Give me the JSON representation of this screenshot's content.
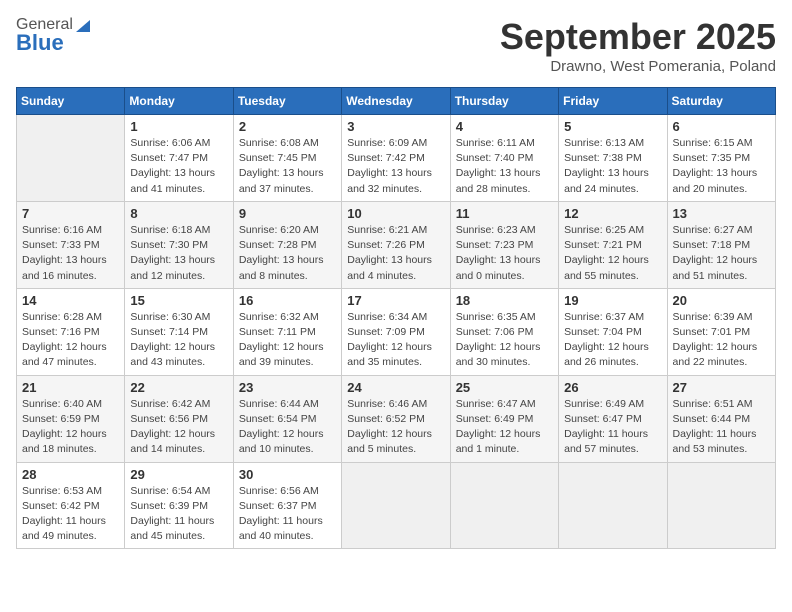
{
  "header": {
    "logo_general": "General",
    "logo_blue": "Blue",
    "month": "September 2025",
    "location": "Drawno, West Pomerania, Poland"
  },
  "weekdays": [
    "Sunday",
    "Monday",
    "Tuesday",
    "Wednesday",
    "Thursday",
    "Friday",
    "Saturday"
  ],
  "weeks": [
    [
      {
        "day": "",
        "info": ""
      },
      {
        "day": "1",
        "info": "Sunrise: 6:06 AM\nSunset: 7:47 PM\nDaylight: 13 hours\nand 41 minutes."
      },
      {
        "day": "2",
        "info": "Sunrise: 6:08 AM\nSunset: 7:45 PM\nDaylight: 13 hours\nand 37 minutes."
      },
      {
        "day": "3",
        "info": "Sunrise: 6:09 AM\nSunset: 7:42 PM\nDaylight: 13 hours\nand 32 minutes."
      },
      {
        "day": "4",
        "info": "Sunrise: 6:11 AM\nSunset: 7:40 PM\nDaylight: 13 hours\nand 28 minutes."
      },
      {
        "day": "5",
        "info": "Sunrise: 6:13 AM\nSunset: 7:38 PM\nDaylight: 13 hours\nand 24 minutes."
      },
      {
        "day": "6",
        "info": "Sunrise: 6:15 AM\nSunset: 7:35 PM\nDaylight: 13 hours\nand 20 minutes."
      }
    ],
    [
      {
        "day": "7",
        "info": "Sunrise: 6:16 AM\nSunset: 7:33 PM\nDaylight: 13 hours\nand 16 minutes."
      },
      {
        "day": "8",
        "info": "Sunrise: 6:18 AM\nSunset: 7:30 PM\nDaylight: 13 hours\nand 12 minutes."
      },
      {
        "day": "9",
        "info": "Sunrise: 6:20 AM\nSunset: 7:28 PM\nDaylight: 13 hours\nand 8 minutes."
      },
      {
        "day": "10",
        "info": "Sunrise: 6:21 AM\nSunset: 7:26 PM\nDaylight: 13 hours\nand 4 minutes."
      },
      {
        "day": "11",
        "info": "Sunrise: 6:23 AM\nSunset: 7:23 PM\nDaylight: 13 hours\nand 0 minutes."
      },
      {
        "day": "12",
        "info": "Sunrise: 6:25 AM\nSunset: 7:21 PM\nDaylight: 12 hours\nand 55 minutes."
      },
      {
        "day": "13",
        "info": "Sunrise: 6:27 AM\nSunset: 7:18 PM\nDaylight: 12 hours\nand 51 minutes."
      }
    ],
    [
      {
        "day": "14",
        "info": "Sunrise: 6:28 AM\nSunset: 7:16 PM\nDaylight: 12 hours\nand 47 minutes."
      },
      {
        "day": "15",
        "info": "Sunrise: 6:30 AM\nSunset: 7:14 PM\nDaylight: 12 hours\nand 43 minutes."
      },
      {
        "day": "16",
        "info": "Sunrise: 6:32 AM\nSunset: 7:11 PM\nDaylight: 12 hours\nand 39 minutes."
      },
      {
        "day": "17",
        "info": "Sunrise: 6:34 AM\nSunset: 7:09 PM\nDaylight: 12 hours\nand 35 minutes."
      },
      {
        "day": "18",
        "info": "Sunrise: 6:35 AM\nSunset: 7:06 PM\nDaylight: 12 hours\nand 30 minutes."
      },
      {
        "day": "19",
        "info": "Sunrise: 6:37 AM\nSunset: 7:04 PM\nDaylight: 12 hours\nand 26 minutes."
      },
      {
        "day": "20",
        "info": "Sunrise: 6:39 AM\nSunset: 7:01 PM\nDaylight: 12 hours\nand 22 minutes."
      }
    ],
    [
      {
        "day": "21",
        "info": "Sunrise: 6:40 AM\nSunset: 6:59 PM\nDaylight: 12 hours\nand 18 minutes."
      },
      {
        "day": "22",
        "info": "Sunrise: 6:42 AM\nSunset: 6:56 PM\nDaylight: 12 hours\nand 14 minutes."
      },
      {
        "day": "23",
        "info": "Sunrise: 6:44 AM\nSunset: 6:54 PM\nDaylight: 12 hours\nand 10 minutes."
      },
      {
        "day": "24",
        "info": "Sunrise: 6:46 AM\nSunset: 6:52 PM\nDaylight: 12 hours\nand 5 minutes."
      },
      {
        "day": "25",
        "info": "Sunrise: 6:47 AM\nSunset: 6:49 PM\nDaylight: 12 hours\nand 1 minute."
      },
      {
        "day": "26",
        "info": "Sunrise: 6:49 AM\nSunset: 6:47 PM\nDaylight: 11 hours\nand 57 minutes."
      },
      {
        "day": "27",
        "info": "Sunrise: 6:51 AM\nSunset: 6:44 PM\nDaylight: 11 hours\nand 53 minutes."
      }
    ],
    [
      {
        "day": "28",
        "info": "Sunrise: 6:53 AM\nSunset: 6:42 PM\nDaylight: 11 hours\nand 49 minutes."
      },
      {
        "day": "29",
        "info": "Sunrise: 6:54 AM\nSunset: 6:39 PM\nDaylight: 11 hours\nand 45 minutes."
      },
      {
        "day": "30",
        "info": "Sunrise: 6:56 AM\nSunset: 6:37 PM\nDaylight: 11 hours\nand 40 minutes."
      },
      {
        "day": "",
        "info": ""
      },
      {
        "day": "",
        "info": ""
      },
      {
        "day": "",
        "info": ""
      },
      {
        "day": "",
        "info": ""
      }
    ]
  ]
}
